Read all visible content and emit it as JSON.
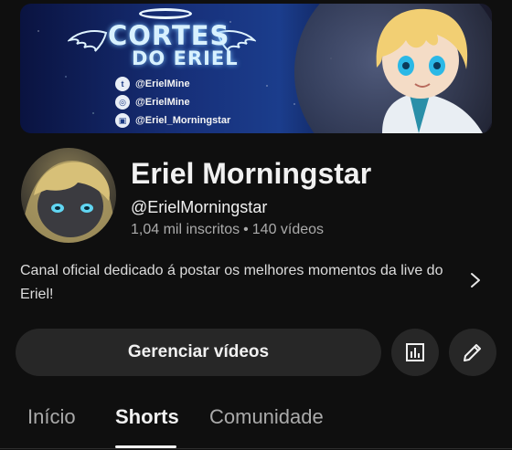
{
  "banner": {
    "title_line1": "CORTES",
    "title_line2": "DO ERIEL",
    "socials": [
      {
        "icon": "twitter-icon",
        "glyph": "t",
        "label": "@ErielMine"
      },
      {
        "icon": "instagram-icon",
        "glyph": "◎",
        "label": "@ErielMine"
      },
      {
        "icon": "twitch-icon",
        "glyph": "▣",
        "label": "@Eriel_Morningstar"
      }
    ]
  },
  "channel": {
    "name": "Eriel Morningstar",
    "handle": "@ErielMorningstar",
    "subscribers": "1,04 mil inscritos",
    "separator": "•",
    "videos": "140 vídeos",
    "description": "Canal oficial dedicado á postar os melhores momentos da live do Eriel!"
  },
  "actions": {
    "manage_label": "Gerenciar vídeos",
    "stats_icon": "analytics-icon",
    "edit_icon": "pencil-icon"
  },
  "tabs": [
    {
      "label": "Início",
      "active": false
    },
    {
      "label": "Shorts",
      "active": true
    },
    {
      "label": "Comunidade",
      "active": false
    }
  ],
  "colors": {
    "background": "#0f0f0f",
    "button": "#272727",
    "secondary_text": "#aaaaaa"
  }
}
